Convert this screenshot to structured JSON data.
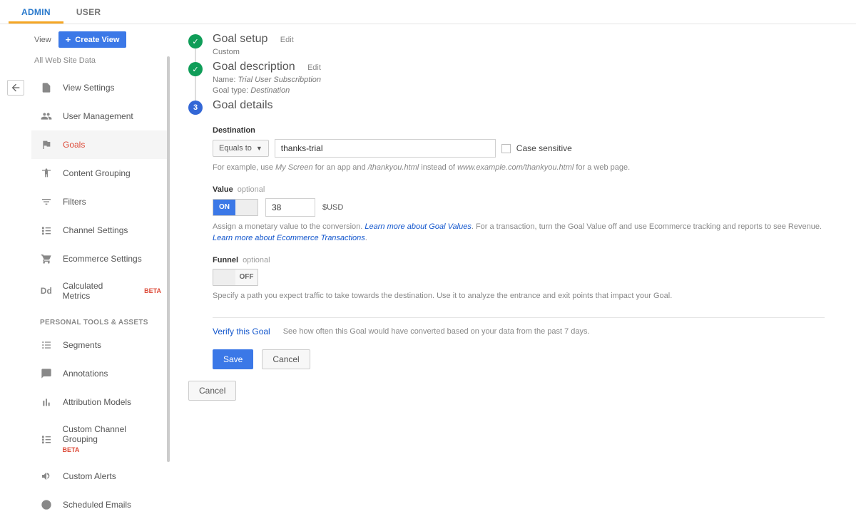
{
  "tabs": {
    "admin": "ADMIN",
    "user": "USER"
  },
  "sidebar": {
    "view_label": "View",
    "create_view": "Create View",
    "all_data": "All Web Site Data",
    "section_header": "PERSONAL TOOLS & ASSETS",
    "items": [
      {
        "label": "View Settings"
      },
      {
        "label": "User Management"
      },
      {
        "label": "Goals"
      },
      {
        "label": "Content Grouping"
      },
      {
        "label": "Filters"
      },
      {
        "label": "Channel Settings"
      },
      {
        "label": "Ecommerce Settings"
      },
      {
        "label": "Calculated Metrics",
        "beta": "BETA"
      }
    ],
    "tools": [
      {
        "label": "Segments"
      },
      {
        "label": "Annotations"
      },
      {
        "label": "Attribution Models"
      },
      {
        "label": "Custom Channel Grouping",
        "beta": "BETA"
      },
      {
        "label": "Custom Alerts"
      },
      {
        "label": "Scheduled Emails"
      }
    ]
  },
  "steps": {
    "setup": {
      "title": "Goal setup",
      "edit": "Edit",
      "sub": "Custom"
    },
    "desc": {
      "title": "Goal description",
      "edit": "Edit",
      "name_label": "Name:",
      "name_value": "Trial User Subscribption",
      "type_label": "Goal type:",
      "type_value": "Destination"
    },
    "details": {
      "num": "3",
      "title": "Goal details"
    }
  },
  "destination": {
    "label": "Destination",
    "match": "Equals to",
    "value": "thanks-trial",
    "case_label": "Case sensitive",
    "help_pre": "For example, use ",
    "help_app": "My Screen",
    "help_mid1": " for an app and ",
    "help_path": "/thankyou.html",
    "help_mid2": " instead of ",
    "help_url": "www.example.com/thankyou.html",
    "help_post": " for a web page."
  },
  "value": {
    "label": "Value",
    "optional": "optional",
    "on": "ON",
    "amount": "38",
    "currency": "$USD",
    "help1": "Assign a monetary value to the conversion. ",
    "link1": "Learn more about Goal Values",
    "help2": ". For a transaction, turn the Goal Value off and use Ecommerce tracking and reports to see Revenue. ",
    "link2": "Learn more about Ecommerce Transactions",
    "help3": "."
  },
  "funnel": {
    "label": "Funnel",
    "optional": "optional",
    "off": "OFF",
    "help": "Specify a path you expect traffic to take towards the destination. Use it to analyze the entrance and exit points that impact your Goal."
  },
  "verify": {
    "link": "Verify this Goal",
    "text": "See how often this Goal would have converted based on your data from the past 7 days."
  },
  "buttons": {
    "save": "Save",
    "cancel": "Cancel",
    "outer_cancel": "Cancel"
  }
}
